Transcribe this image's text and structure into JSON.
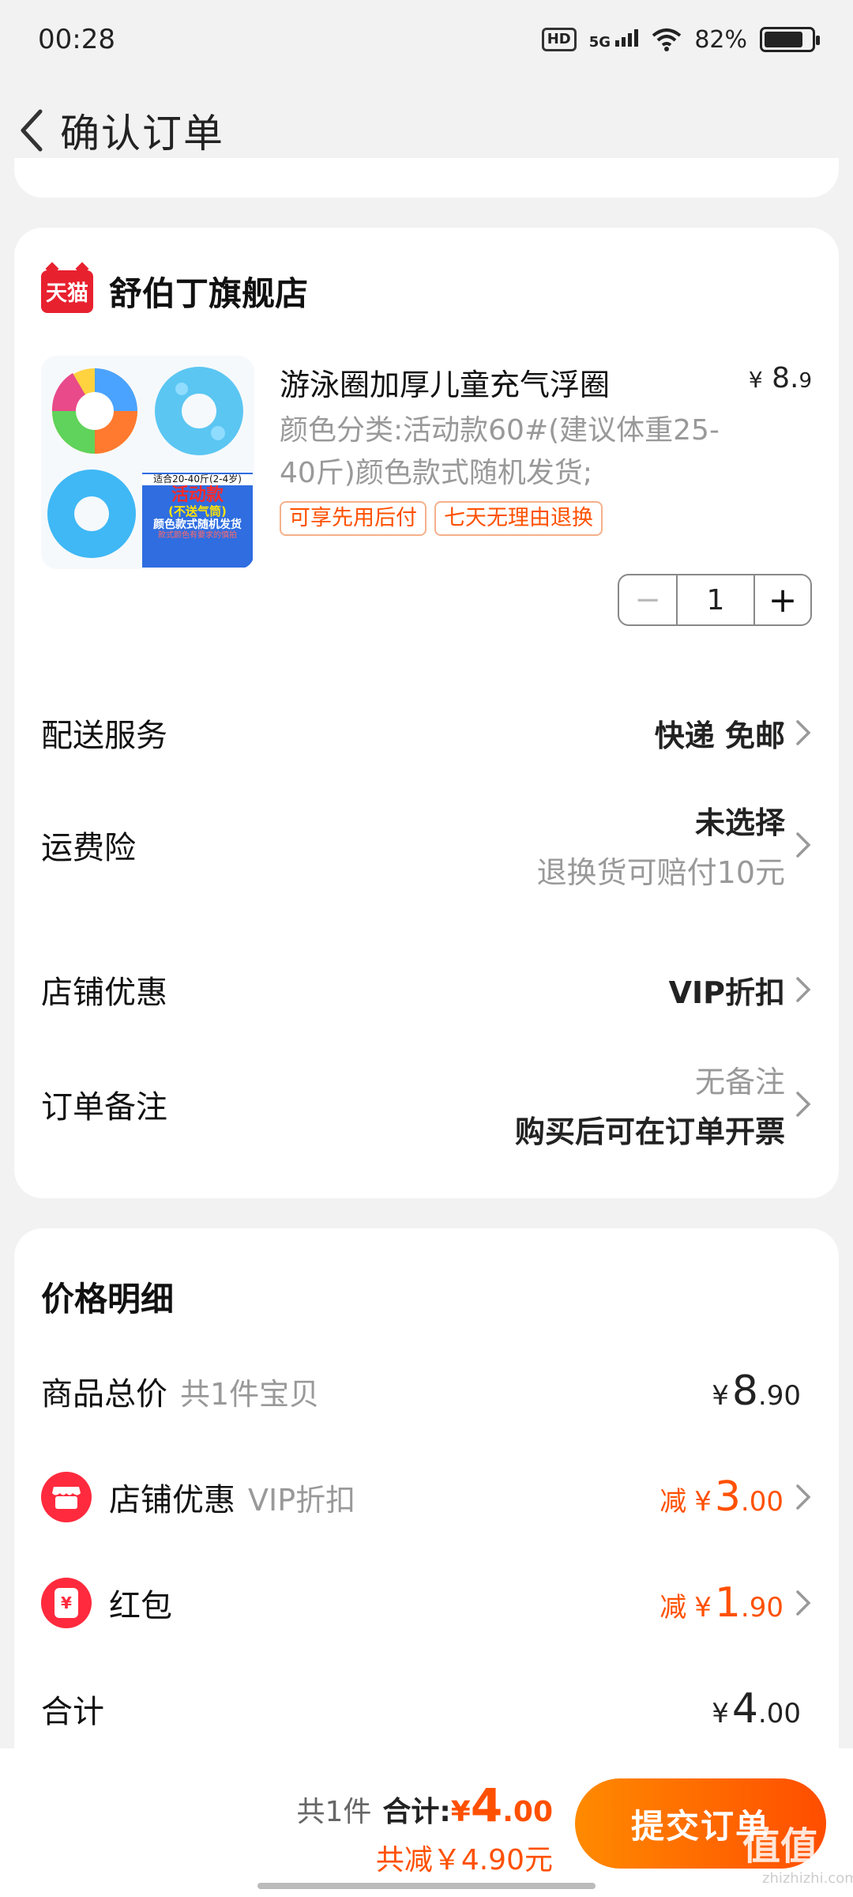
{
  "status_bar": {
    "time": "00:28",
    "hd": "HD",
    "network": "5G",
    "battery_text": "82%",
    "battery_level": 0.82
  },
  "nav": {
    "title": "确认订单"
  },
  "store": {
    "logo_text": "天猫",
    "name": "舒伯丁旗舰店"
  },
  "product": {
    "title": "游泳圈加厚儿童充气浮圈",
    "price_yen": "¥",
    "price_int": "8.",
    "price_dec": "9",
    "sku": "颜色分类:活动款60#(建议体重25-40斤)颜色款式随机发货;",
    "image_text": {
      "line1": "适合20-40斤(2-4岁)",
      "line2": "活动款",
      "line3": "(不送气筒)",
      "line4": "颜色款式随机发货",
      "line5": "款式颜色有要求的慎拍"
    },
    "tags": [
      "可享先用后付",
      "七天无理由退换"
    ],
    "quantity": "1",
    "minus": "−",
    "plus": "+"
  },
  "rows": {
    "delivery": {
      "label": "配送服务",
      "value": "快递 免邮"
    },
    "insurance": {
      "label": "运费险",
      "value": "未选择",
      "sub": "退换货可赔付10元"
    },
    "discount": {
      "label": "店铺优惠",
      "value": "VIP折扣"
    },
    "note": {
      "label": "订单备注",
      "value": "无备注",
      "sub": "购买后可在订单开票"
    }
  },
  "price": {
    "title": "价格明细",
    "goods": {
      "label": "商品总价",
      "hint": "共1件宝贝",
      "yen": "¥",
      "int": "8",
      "dec": ".90"
    },
    "store_discount": {
      "label": "店铺优惠",
      "hint": "VIP折扣",
      "minus": "减",
      "yen": "¥",
      "int": "3",
      "dec": ".00"
    },
    "red_packet": {
      "label": "红包",
      "icon_text": "¥",
      "minus": "减",
      "yen": "¥",
      "int": "1",
      "dec": ".90"
    },
    "total": {
      "label": "合计",
      "yen": "¥",
      "int": "4",
      "dec": ".00"
    }
  },
  "bottom": {
    "count": "共1件",
    "total_label": "合计:",
    "yen": "¥",
    "int": "4",
    "dec": ".00",
    "saved": "共减￥4.90元",
    "submit": "提交订单"
  },
  "watermark": {
    "text": "值值值",
    "sub": "zhizhizhi.com"
  },
  "colors": {
    "accent": "#ff5000",
    "tmall": "#e8212f",
    "icon_red": "#ff2a3d"
  }
}
